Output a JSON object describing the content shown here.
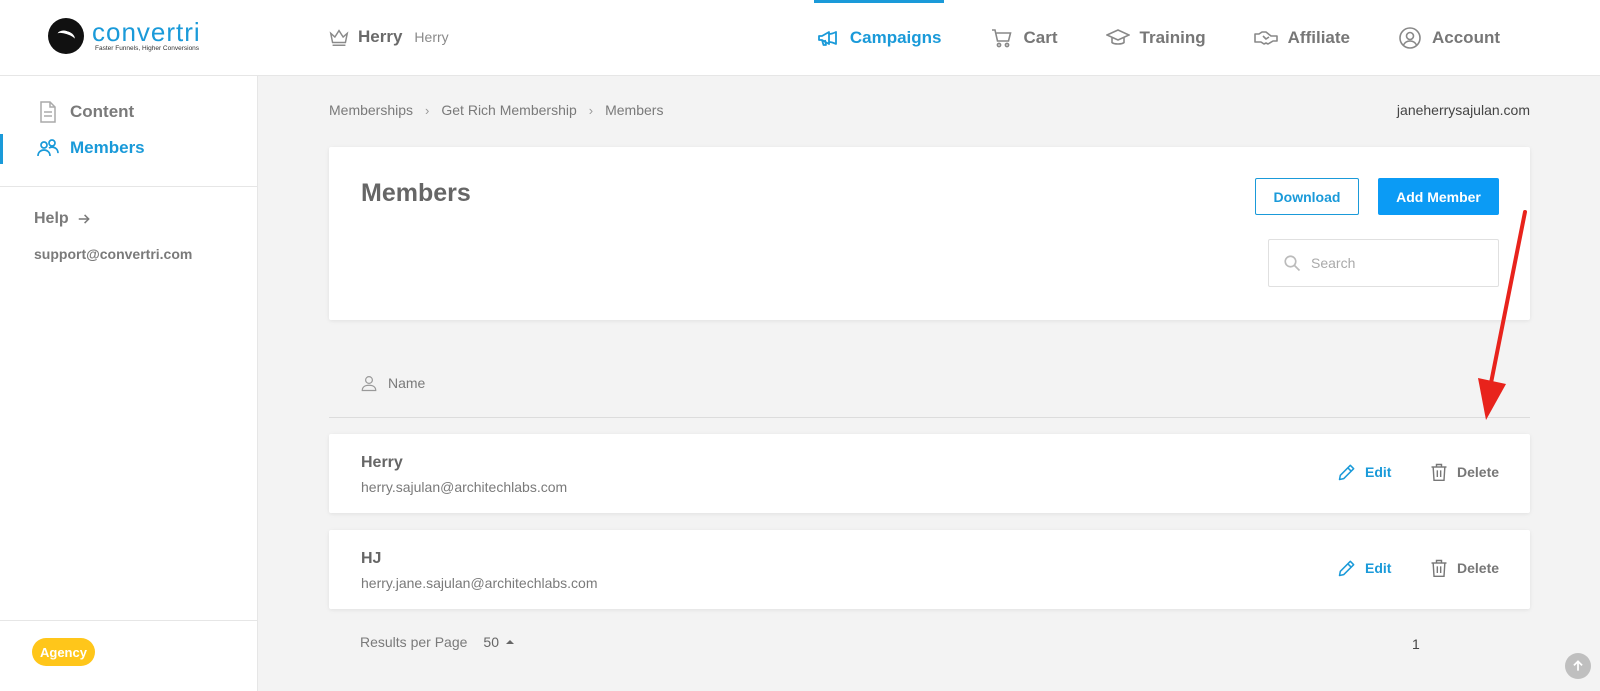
{
  "header": {
    "logo_name": "convertri",
    "logo_tagline": "Faster Funnels, Higher Conversions",
    "site_name": "Herry",
    "site_subname": "Herry",
    "nav": [
      {
        "label": "Campaigns",
        "icon": "megaphone-icon",
        "active": true
      },
      {
        "label": "Cart",
        "icon": "cart-icon",
        "active": false
      },
      {
        "label": "Training",
        "icon": "graduation-cap-icon",
        "active": false
      },
      {
        "label": "Affiliate",
        "icon": "handshake-icon",
        "active": false
      },
      {
        "label": "Account",
        "icon": "user-circle-icon",
        "active": false
      }
    ]
  },
  "sidebar": {
    "items": [
      {
        "label": "Content",
        "icon": "document-icon",
        "active": false
      },
      {
        "label": "Members",
        "icon": "users-icon",
        "active": true
      }
    ],
    "help_label": "Help",
    "support_email": "support@convertri.com",
    "plan_badge": "Agency"
  },
  "breadcrumb": [
    "Memberships",
    "Get Rich Membership",
    "Members"
  ],
  "domain": "janeherrysajulan.com",
  "panel": {
    "title": "Members",
    "download_label": "Download",
    "add_member_label": "Add Member",
    "search_placeholder": "Search"
  },
  "table": {
    "column_name": "Name",
    "rows": [
      {
        "name": "Herry",
        "email": "herry.sajulan@architechlabs.com",
        "edit_label": "Edit",
        "delete_label": "Delete"
      },
      {
        "name": "HJ",
        "email": "herry.jane.sajulan@architechlabs.com",
        "edit_label": "Edit",
        "delete_label": "Delete"
      }
    ]
  },
  "pagination": {
    "results_label": "Results per Page",
    "per_page": "50",
    "current_page": "1"
  },
  "colors": {
    "accent": "#1a9ad9",
    "primary_button": "#0b9bf5",
    "badge": "#ffc61a",
    "annotation": "#e8231c"
  }
}
